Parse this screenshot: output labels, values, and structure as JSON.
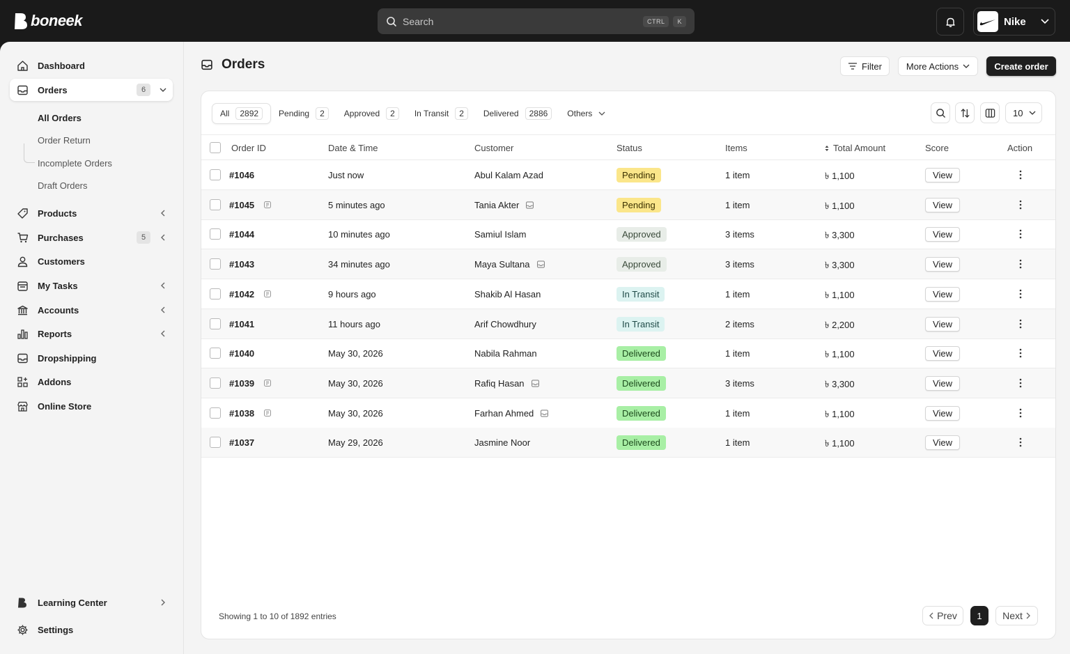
{
  "brand": {
    "name": "boneek"
  },
  "search": {
    "placeholder": "Search",
    "shortcut_ctrl": "CTRL",
    "shortcut_key": "K"
  },
  "account": {
    "name": "Nike"
  },
  "sidebar": {
    "items": [
      {
        "label": "Dashboard"
      },
      {
        "label": "Orders",
        "badge": "6"
      },
      {
        "label": "Products"
      },
      {
        "label": "Purchases",
        "badge": "5"
      },
      {
        "label": "Customers"
      },
      {
        "label": "My Tasks"
      },
      {
        "label": "Accounts"
      },
      {
        "label": "Reports"
      },
      {
        "label": "Dropshipping"
      },
      {
        "label": "Addons"
      },
      {
        "label": "Online Store"
      }
    ],
    "orders_sub": [
      "All Orders",
      "Order Return",
      "Incomplete Orders",
      "Draft Orders"
    ],
    "bottom": [
      {
        "label": "Learning Center"
      },
      {
        "label": "Settings"
      }
    ]
  },
  "page": {
    "title": "Orders",
    "filter_label": "Filter",
    "more_actions_label": "More Actions",
    "create_label": "Create order"
  },
  "tabs": [
    {
      "label": "All",
      "count": "2892"
    },
    {
      "label": "Pending",
      "count": "2"
    },
    {
      "label": "Approved",
      "count": "2"
    },
    {
      "label": "In Transit",
      "count": "2"
    },
    {
      "label": "Delivered",
      "count": "2886"
    },
    {
      "label": "Others"
    }
  ],
  "page_size": "10",
  "table": {
    "columns": [
      "Order ID",
      "Date & Time",
      "Customer",
      "Status",
      "Items",
      "Total Amount",
      "Score",
      "Action"
    ],
    "view_label": "View",
    "rows": [
      {
        "id": "#1046",
        "date": "Just now",
        "customer": "Abul Kalam Azad",
        "status": "Pending",
        "items": "1 item",
        "total": "৳ 1,100",
        "id_icon": false,
        "cust_icon": false
      },
      {
        "id": "#1045",
        "date": "5 minutes ago",
        "customer": "Tania Akter",
        "status": "Pending",
        "items": "1 item",
        "total": "৳ 1,100",
        "id_icon": true,
        "cust_icon": true
      },
      {
        "id": "#1044",
        "date": "10 minutes ago",
        "customer": "Samiul Islam",
        "status": "Approved",
        "items": "3 items",
        "total": "৳ 3,300",
        "id_icon": false,
        "cust_icon": false
      },
      {
        "id": "#1043",
        "date": "34 minutes ago",
        "customer": "Maya Sultana",
        "status": "Approved",
        "items": "3 items",
        "total": "৳ 3,300",
        "id_icon": false,
        "cust_icon": true
      },
      {
        "id": "#1042",
        "date": "9 hours ago",
        "customer": "Shakib Al Hasan",
        "status": "In Transit",
        "items": "1 item",
        "total": "৳ 1,100",
        "id_icon": true,
        "cust_icon": false
      },
      {
        "id": "#1041",
        "date": "11 hours ago",
        "customer": "Arif Chowdhury",
        "status": "In Transit",
        "items": "2 items",
        "total": "৳ 2,200",
        "id_icon": false,
        "cust_icon": false
      },
      {
        "id": "#1040",
        "date": "May 30, 2026",
        "customer": "Nabila Rahman",
        "status": "Delivered",
        "items": "1 item",
        "total": "৳ 1,100",
        "id_icon": false,
        "cust_icon": false
      },
      {
        "id": "#1039",
        "date": "May 30, 2026",
        "customer": "Rafiq Hasan",
        "status": "Delivered",
        "items": "3 items",
        "total": "৳ 3,300",
        "id_icon": true,
        "cust_icon": true
      },
      {
        "id": "#1038",
        "date": "May 30, 2026",
        "customer": "Farhan Ahmed",
        "status": "Delivered",
        "items": "1 item",
        "total": "৳ 1,100",
        "id_icon": true,
        "cust_icon": true
      },
      {
        "id": "#1037",
        "date": "May 29, 2026",
        "customer": "Jasmine Noor",
        "status": "Delivered",
        "items": "1 item",
        "total": "৳ 1,100",
        "id_icon": false,
        "cust_icon": false
      }
    ]
  },
  "status_colors": {
    "Pending": {
      "bg": "#fbe68a",
      "fg": "#3a3000"
    },
    "Approved": {
      "bg": "#e8ede8",
      "fg": "#3a4a3a"
    },
    "In Transit": {
      "bg": "#dcf3f1",
      "fg": "#1f4a47"
    },
    "Delivered": {
      "bg": "#a8efa5",
      "fg": "#1c4a1c"
    }
  },
  "footer": {
    "showing": "Showing 1 to 10 of 1892 entries",
    "prev": "Prev",
    "current_page": "1",
    "next": "Next"
  }
}
